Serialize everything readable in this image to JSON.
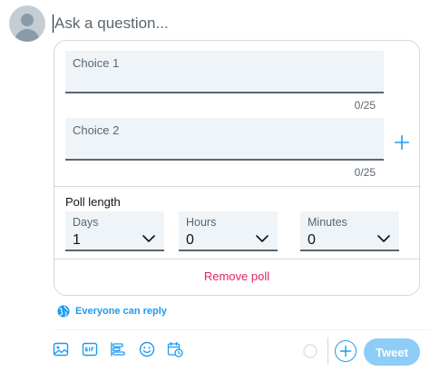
{
  "composer": {
    "placeholder": "Ask a question..."
  },
  "poll": {
    "choices": [
      {
        "label": "Choice 1",
        "counter": "0/25"
      },
      {
        "label": "Choice 2",
        "counter": "0/25"
      }
    ],
    "add_choice_icon": "plus-icon",
    "length_title": "Poll length",
    "length": {
      "days": {
        "label": "Days",
        "value": "1"
      },
      "hours": {
        "label": "Hours",
        "value": "0"
      },
      "minutes": {
        "label": "Minutes",
        "value": "0"
      }
    },
    "remove_label": "Remove poll"
  },
  "reply": {
    "label": "Everyone can reply",
    "icon": "globe-icon"
  },
  "toolbar": {
    "icons": [
      "image-icon",
      "gif-icon",
      "poll-icon",
      "emoji-icon",
      "schedule-icon"
    ],
    "add_icon": "plus-icon",
    "tweet_label": "Tweet"
  },
  "colors": {
    "accent": "#1d9bf0",
    "danger": "#e0245e",
    "tweet_disabled": "#8ecdf8",
    "field_bg": "#eff4f8"
  }
}
